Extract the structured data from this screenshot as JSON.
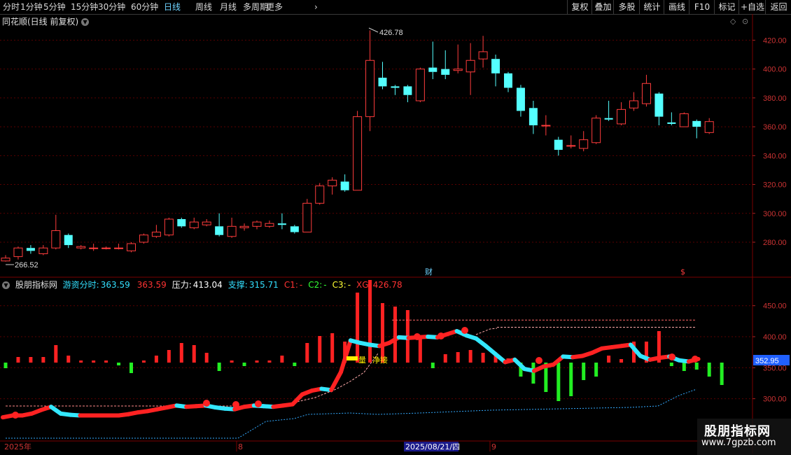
{
  "toolbar": {
    "periods": [
      "分时",
      "1分钟",
      "5分钟",
      "15分钟",
      "30分钟",
      "60分钟",
      "日线",
      "周线",
      "月线",
      "多周期",
      "更多"
    ],
    "active_period": "日线",
    "more_arrow": "›",
    "right_buttons": [
      "复权",
      "叠加",
      "多股",
      "统计",
      "画线",
      "F10",
      "标记",
      "+自选",
      "返回"
    ]
  },
  "main_panel": {
    "title": "同花顺(日线 前复权)",
    "title_icon": "chevron-down-icon",
    "high_label": "426.78",
    "low_label": "266.52",
    "marker_cai": "财",
    "marker_s": "$",
    "y_ticks": [
      "420.00",
      "400.00",
      "380.00",
      "360.00",
      "340.00",
      "320.00",
      "300.00",
      "280.00"
    ]
  },
  "indicator_panel": {
    "name": "股朋指标网",
    "fields": [
      {
        "label": "游资分时:",
        "value": "363.59",
        "color": "#33e0ff"
      },
      {
        "label": "",
        "value": "363.59",
        "color": "#ff3333"
      },
      {
        "label": "压力:",
        "value": "413.04",
        "color": "#ffffff"
      },
      {
        "label": "支撑:",
        "value": "315.71",
        "color": "#33e0ff"
      },
      {
        "label": "C1:",
        "value": "-",
        "color": "#ff3333"
      },
      {
        "label": "C2:",
        "value": "-",
        "color": "#33ff33"
      },
      {
        "label": "C3:",
        "value": "-",
        "color": "#ffff33"
      },
      {
        "label": "XG:",
        "value": "426.78",
        "color": "#ff3333"
      }
    ],
    "y_ticks": [
      "450.00",
      "400.00",
      "350.00",
      "300.00"
    ],
    "current_price_tag": "352.95",
    "annotation_jingjie": "净接",
    "annotation_box": "量"
  },
  "x_axis": {
    "labels": [
      "2025年",
      "8",
      "2025/08/21/四",
      "9"
    ]
  },
  "watermark": {
    "title": "股朋指标网",
    "url": "www.7gpzb.com"
  },
  "colors": {
    "up": "#ff3c3c",
    "down": "#54ffff",
    "grid": "#5a0000",
    "axis_text": "#cc3333"
  },
  "chart_data": {
    "type": "candlestick",
    "ylim": [
      260,
      430
    ],
    "candles": [
      {
        "o": 267,
        "c": 269,
        "h": 271,
        "l": 266.52
      },
      {
        "o": 270,
        "c": 276,
        "h": 277,
        "l": 268
      },
      {
        "o": 276,
        "c": 274,
        "h": 278,
        "l": 272
      },
      {
        "o": 272,
        "c": 276,
        "h": 278,
        "l": 271
      },
      {
        "o": 276,
        "c": 288,
        "h": 299,
        "l": 275
      },
      {
        "o": 285,
        "c": 278,
        "h": 286,
        "l": 276
      },
      {
        "o": 276,
        "c": 277,
        "h": 278,
        "l": 275
      },
      {
        "o": 276,
        "c": 276,
        "h": 279,
        "l": 274
      },
      {
        "o": 276,
        "c": 276,
        "h": 277,
        "l": 275
      },
      {
        "o": 276,
        "c": 276,
        "h": 279,
        "l": 275
      },
      {
        "o": 274,
        "c": 279,
        "h": 280,
        "l": 273
      },
      {
        "o": 280,
        "c": 285,
        "h": 286,
        "l": 279
      },
      {
        "o": 284,
        "c": 287,
        "h": 292,
        "l": 283
      },
      {
        "o": 285,
        "c": 296,
        "h": 297,
        "l": 284
      },
      {
        "o": 296,
        "c": 291,
        "h": 297,
        "l": 290
      },
      {
        "o": 290,
        "c": 294,
        "h": 297,
        "l": 289
      },
      {
        "o": 292,
        "c": 294,
        "h": 296,
        "l": 291
      },
      {
        "o": 291,
        "c": 285,
        "h": 300,
        "l": 284
      },
      {
        "o": 284,
        "c": 291,
        "h": 297,
        "l": 283
      },
      {
        "o": 290,
        "c": 291,
        "h": 293,
        "l": 288
      },
      {
        "o": 291,
        "c": 294,
        "h": 295,
        "l": 289
      },
      {
        "o": 291,
        "c": 293,
        "h": 295,
        "l": 290
      },
      {
        "o": 293,
        "c": 292,
        "h": 300,
        "l": 289
      },
      {
        "o": 291,
        "c": 287,
        "h": 292,
        "l": 286
      },
      {
        "o": 287,
        "c": 307,
        "h": 310,
        "l": 287
      },
      {
        "o": 307,
        "c": 319,
        "h": 321,
        "l": 306
      },
      {
        "o": 319,
        "c": 323,
        "h": 325,
        "l": 313
      },
      {
        "o": 322,
        "c": 316,
        "h": 327,
        "l": 315
      },
      {
        "o": 316,
        "c": 367,
        "h": 371,
        "l": 316
      },
      {
        "o": 367,
        "c": 406,
        "h": 426.78,
        "l": 357
      },
      {
        "o": 394,
        "c": 388,
        "h": 405,
        "l": 386
      },
      {
        "o": 388,
        "c": 387,
        "h": 389,
        "l": 382
      },
      {
        "o": 388,
        "c": 382,
        "h": 389,
        "l": 377
      },
      {
        "o": 378,
        "c": 400,
        "h": 401,
        "l": 377
      },
      {
        "o": 401,
        "c": 398,
        "h": 419,
        "l": 393
      },
      {
        "o": 400,
        "c": 396,
        "h": 413,
        "l": 393
      },
      {
        "o": 399,
        "c": 400,
        "h": 417,
        "l": 397
      },
      {
        "o": 398,
        "c": 406,
        "h": 418,
        "l": 382
      },
      {
        "o": 407,
        "c": 412,
        "h": 423,
        "l": 401
      },
      {
        "o": 407,
        "c": 397,
        "h": 410,
        "l": 388
      },
      {
        "o": 397,
        "c": 387,
        "h": 398,
        "l": 384
      },
      {
        "o": 387,
        "c": 371,
        "h": 389,
        "l": 367
      },
      {
        "o": 373,
        "c": 361,
        "h": 378,
        "l": 355
      },
      {
        "o": 361,
        "c": 361,
        "h": 368,
        "l": 354
      },
      {
        "o": 351,
        "c": 344,
        "h": 353,
        "l": 340
      },
      {
        "o": 347,
        "c": 347,
        "h": 354,
        "l": 345
      },
      {
        "o": 345,
        "c": 351,
        "h": 357,
        "l": 343
      },
      {
        "o": 349,
        "c": 366,
        "h": 368,
        "l": 348
      },
      {
        "o": 366,
        "c": 365,
        "h": 378,
        "l": 364
      },
      {
        "o": 362,
        "c": 372,
        "h": 377,
        "l": 361
      },
      {
        "o": 373,
        "c": 378,
        "h": 384,
        "l": 371
      },
      {
        "o": 376,
        "c": 390,
        "h": 396,
        "l": 374
      },
      {
        "o": 383,
        "c": 367,
        "h": 384,
        "l": 361
      },
      {
        "o": 363,
        "c": 362,
        "h": 370,
        "l": 361
      },
      {
        "o": 360,
        "c": 369,
        "h": 370,
        "l": 360
      },
      {
        "o": 364,
        "c": 360,
        "h": 365,
        "l": 352
      },
      {
        "o": 356,
        "c": 363.59,
        "h": 366,
        "l": 355
      }
    ],
    "indicator": {
      "ylim": [
        260,
        480
      ],
      "line": [
        270,
        273,
        273,
        276,
        282,
        287,
        276,
        274,
        273,
        273,
        273,
        273,
        273,
        275,
        278,
        280,
        283,
        286,
        289,
        287,
        288,
        289,
        286,
        284,
        283,
        287,
        289,
        288,
        287,
        289,
        291,
        307,
        313,
        316,
        314,
        343,
        394,
        390,
        387,
        385,
        390,
        399,
        398,
        399,
        400,
        399,
        404,
        409,
        402,
        397,
        385,
        372,
        359,
        363,
        348,
        345,
        352,
        355,
        368,
        367,
        369,
        374,
        381,
        383,
        385,
        387,
        369,
        363,
        366,
        368,
        362,
        360,
        364
      ],
      "hist": [
        {
          "v": 8,
          "up": false
        },
        {
          "v": 8,
          "up": true
        },
        {
          "v": 8,
          "up": true
        },
        {
          "v": 8,
          "up": true
        },
        {
          "v": 25,
          "up": true
        },
        {
          "v": 10,
          "up": true
        },
        {
          "v": 3,
          "up": true
        },
        {
          "v": 3,
          "up": true
        },
        {
          "v": 3,
          "up": true
        },
        {
          "v": 4,
          "up": false
        },
        {
          "v": 15,
          "up": false
        },
        {
          "v": 3,
          "up": true
        },
        {
          "v": 10,
          "up": true
        },
        {
          "v": 18,
          "up": true
        },
        {
          "v": 28,
          "up": true
        },
        {
          "v": 25,
          "up": true
        },
        {
          "v": 14,
          "up": true
        },
        {
          "v": 12,
          "up": false
        },
        {
          "v": 3,
          "up": true
        },
        {
          "v": 5,
          "up": false
        },
        {
          "v": 3,
          "up": true
        },
        {
          "v": 3,
          "up": true
        },
        {
          "v": 10,
          "up": true
        },
        {
          "v": 5,
          "up": false
        },
        {
          "v": 28,
          "up": true
        },
        {
          "v": 38,
          "up": true
        },
        {
          "v": 42,
          "up": true
        },
        {
          "v": 30,
          "up": true
        },
        {
          "v": 100,
          "up": true
        },
        {
          "v": 118,
          "up": true
        },
        {
          "v": 85,
          "up": true
        },
        {
          "v": 80,
          "up": true
        },
        {
          "v": 75,
          "up": true
        },
        {
          "v": 38,
          "up": true
        },
        {
          "v": 8,
          "up": false
        },
        {
          "v": 12,
          "up": true
        },
        {
          "v": 15,
          "up": true
        },
        {
          "v": 18,
          "up": true
        },
        {
          "v": 14,
          "up": true
        },
        {
          "v": 10,
          "up": true
        },
        {
          "v": 6,
          "up": true
        },
        {
          "v": 20,
          "up": false
        },
        {
          "v": 30,
          "up": false
        },
        {
          "v": 42,
          "up": false
        },
        {
          "v": 55,
          "up": false
        },
        {
          "v": 48,
          "up": false
        },
        {
          "v": 25,
          "up": false
        },
        {
          "v": 20,
          "up": false
        },
        {
          "v": 10,
          "up": true
        },
        {
          "v": 5,
          "up": true
        },
        {
          "v": 30,
          "up": true
        },
        {
          "v": 30,
          "up": true
        },
        {
          "v": 45,
          "up": true
        },
        {
          "v": 5,
          "up": false
        },
        {
          "v": 12,
          "up": false
        },
        {
          "v": 10,
          "up": false
        },
        {
          "v": 20,
          "up": false
        },
        {
          "v": 32,
          "up": false
        }
      ],
      "pressure_level": 413.04,
      "pressure_level2": 426.78,
      "support_start": 266,
      "support_end": 315.71
    }
  }
}
